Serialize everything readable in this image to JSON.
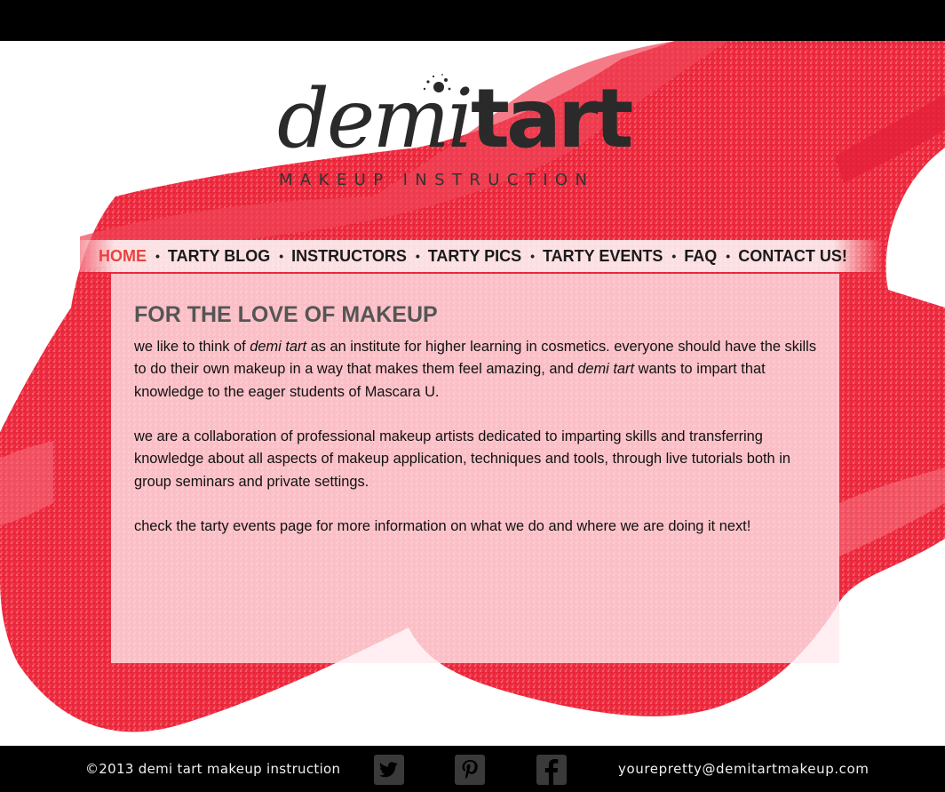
{
  "logo": {
    "word_demi": "demi",
    "word_tart": "tart",
    "tagline": "MAKEUP INSTRUCTION"
  },
  "nav": {
    "items": [
      {
        "label": "HOME",
        "active": true
      },
      {
        "label": "TARTY BLOG"
      },
      {
        "label": "INSTRUCTORS"
      },
      {
        "label": "TARTY PICS"
      },
      {
        "label": "TARTY EVENTS"
      },
      {
        "label": "FAQ"
      },
      {
        "label": "CONTACT US!"
      }
    ],
    "separator": "•"
  },
  "main": {
    "heading": "FOR THE LOVE OF MAKEUP",
    "p1_a": "we like to think of ",
    "p1_brand1": "demi tart",
    "p1_b": " as an institute for higher learning in cosmetics.  everyone should have the skills to do their own makeup in a way that makes them feel amazing, and ",
    "p1_brand2": "demi tart",
    "p1_c": " wants to impart that knowledge to the eager students of Mascara U.",
    "p2": "we are a collaboration of professional makeup artists dedicated to imparting skills and transferring knowledge about all aspects of makeup application, techniques and tools, through live tutorials both in group seminars and private settings.",
    "p3": "check the tarty events page for more information on what we do and where we are doing it next!"
  },
  "footer": {
    "copyright": "©2013 demi tart makeup instruction",
    "email": "yourepretty@demitartmakeup.com",
    "social_icons": [
      "twitter-icon",
      "pinterest-icon",
      "facebook-icon"
    ]
  },
  "colors": {
    "accent": "#e8433f",
    "lipstick": "#ee2a3e",
    "background": "#000000"
  }
}
